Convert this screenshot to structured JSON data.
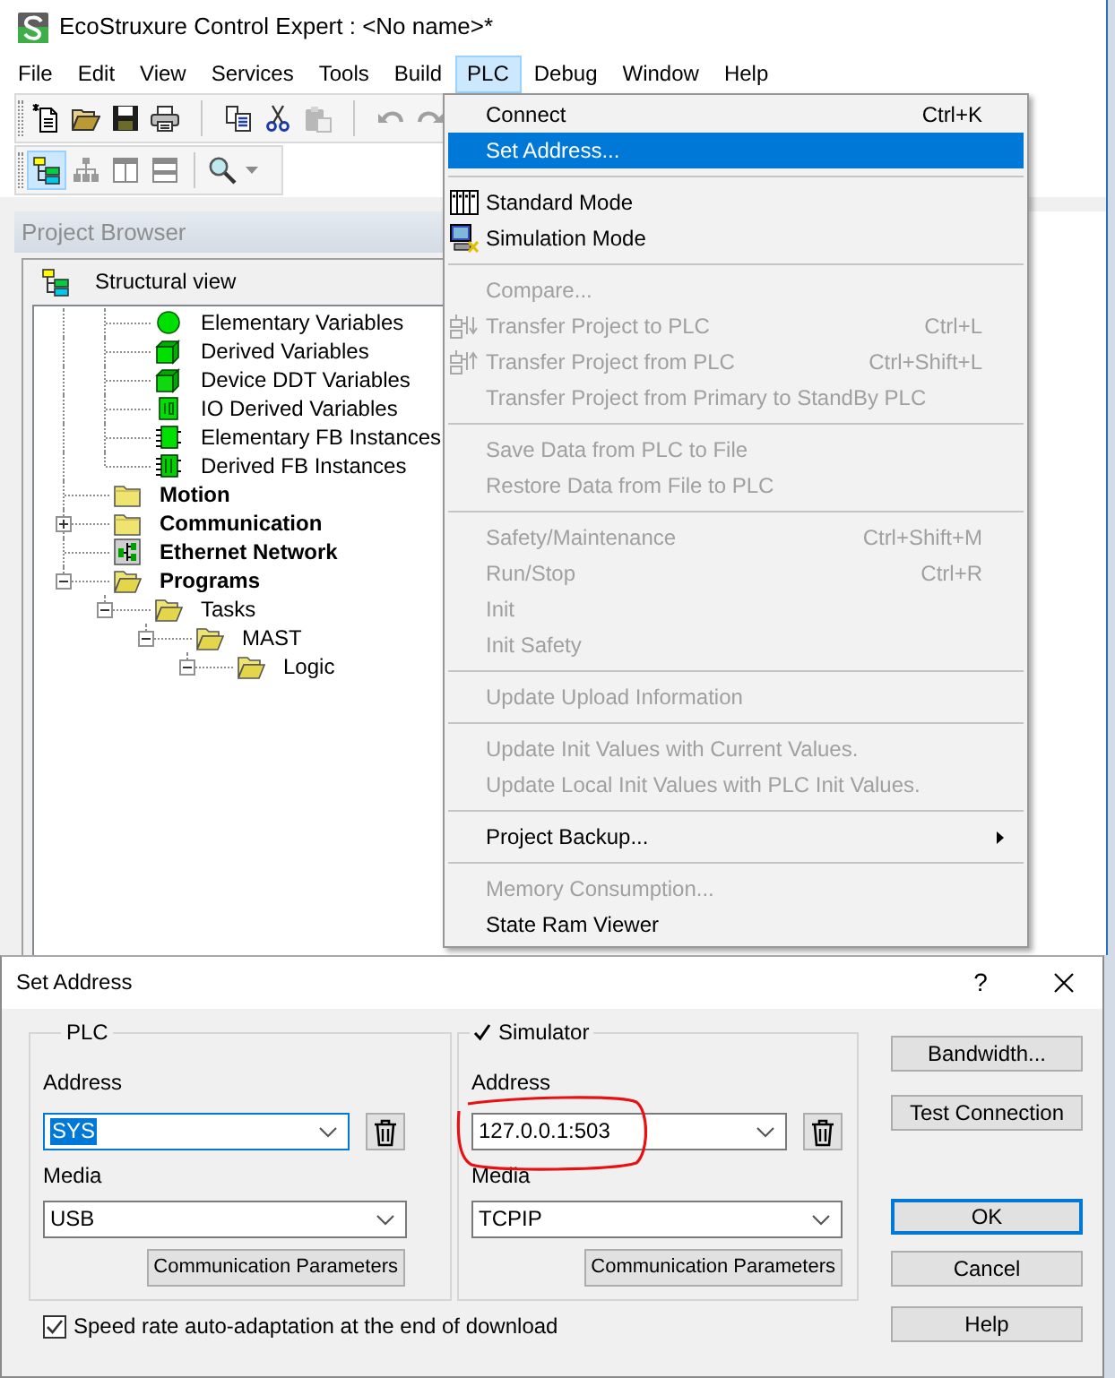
{
  "window": {
    "title": "EcoStruxure Control Expert : <No name>*"
  },
  "menu_bar": [
    {
      "label": "File",
      "selected": false
    },
    {
      "label": "Edit",
      "selected": false
    },
    {
      "label": "View",
      "selected": false
    },
    {
      "label": "Services",
      "selected": false
    },
    {
      "label": "Tools",
      "selected": false
    },
    {
      "label": "Build",
      "selected": false
    },
    {
      "label": "PLC",
      "selected": true
    },
    {
      "label": "Debug",
      "selected": false
    },
    {
      "label": "Window",
      "selected": false
    },
    {
      "label": "Help",
      "selected": false
    }
  ],
  "toolbars": [
    {
      "groups": [
        [
          {
            "kind": "new",
            "disabled": false
          },
          {
            "kind": "open",
            "disabled": false
          },
          {
            "kind": "save",
            "disabled": false
          },
          {
            "kind": "print",
            "disabled": false
          }
        ],
        [
          {
            "kind": "copy",
            "disabled": false
          },
          {
            "kind": "cut",
            "disabled": false
          },
          {
            "kind": "paste",
            "disabled": true
          }
        ],
        [
          {
            "kind": "undo",
            "disabled": true
          },
          {
            "kind": "redo",
            "disabled": true
          }
        ]
      ]
    },
    {
      "groups": [
        [
          {
            "kind": "structural-view",
            "disabled": false,
            "pressed": true
          },
          {
            "kind": "functional-view",
            "disabled": false,
            "pressed": false
          },
          {
            "kind": "two-pane",
            "disabled": false,
            "pressed": false
          },
          {
            "kind": "split-pane",
            "disabled": false,
            "pressed": false
          }
        ],
        [
          {
            "kind": "zoom",
            "disabled": false,
            "pressed": false
          }
        ]
      ]
    }
  ],
  "project_browser": {
    "title": "Project Browser",
    "view": "Structural view",
    "tree": [
      {
        "children": [
          {
            "kind": "elementary-variable",
            "label": "Elementary Variables"
          },
          {
            "kind": "derived-variable",
            "label": "Derived Variables"
          },
          {
            "kind": "device-ddt",
            "label": "Device DDT Variables"
          },
          {
            "kind": "io-derived",
            "label": "IO Derived Variables"
          },
          {
            "kind": "elementary-fb",
            "label": "Elementary FB Instances"
          },
          {
            "kind": "derived-fb",
            "label": "Derived FB Instances"
          }
        ]
      },
      {
        "kind": "folder",
        "label": "Motion"
      },
      {
        "kind": "folder",
        "label": "Communication",
        "expanded": false
      },
      {
        "kind": "network",
        "label": "Ethernet Network"
      },
      {
        "kind": "folder",
        "label": "Programs",
        "expanded": true,
        "children": [
          {
            "kind": "folder",
            "label": "Tasks",
            "expanded": true,
            "children": [
              {
                "kind": "folder",
                "label": "MAST",
                "expanded": true,
                "children": [
                  {
                    "kind": "folder",
                    "label": "Logic",
                    "expanded": true
                  }
                ]
              }
            ]
          }
        ]
      }
    ]
  },
  "menu": {
    "items": [
      {
        "kind": "plain",
        "label": "Connect",
        "shortcut": "Ctrl+K",
        "disabled": false,
        "selected": false
      },
      {
        "kind": "plain",
        "label": "Set Address...",
        "disabled": false,
        "selected": true
      },
      {
        "kind": "separator"
      },
      {
        "kind": "rack",
        "label": "Standard Mode",
        "disabled": false,
        "selected": false
      },
      {
        "kind": "simulator",
        "label": "Simulation Mode",
        "disabled": false,
        "selected": false
      },
      {
        "kind": "separator"
      },
      {
        "kind": "plain",
        "label": "Compare...",
        "disabled": true,
        "selected": false
      },
      {
        "kind": "transfer-to",
        "label": "Transfer Project to PLC",
        "shortcut": "Ctrl+L",
        "disabled": true,
        "selected": false
      },
      {
        "kind": "transfer-from",
        "label": "Transfer Project from PLC",
        "shortcut": "Ctrl+Shift+L",
        "disabled": true,
        "selected": false
      },
      {
        "kind": "plain",
        "label": "Transfer Project from Primary to StandBy PLC",
        "disabled": true,
        "selected": false
      },
      {
        "kind": "separator"
      },
      {
        "kind": "plain",
        "label": "Save Data from PLC to File",
        "disabled": true,
        "selected": false
      },
      {
        "kind": "plain",
        "label": "Restore Data from File to PLC",
        "disabled": true,
        "selected": false
      },
      {
        "kind": "separator"
      },
      {
        "kind": "plain",
        "label": "Safety/Maintenance",
        "shortcut": "Ctrl+Shift+M",
        "disabled": true,
        "selected": false
      },
      {
        "kind": "plain",
        "label": "Run/Stop",
        "shortcut": "Ctrl+R",
        "disabled": true,
        "selected": false
      },
      {
        "kind": "plain",
        "label": "Init",
        "disabled": true,
        "selected": false
      },
      {
        "kind": "plain",
        "label": "Init Safety",
        "disabled": true,
        "selected": false
      },
      {
        "kind": "separator"
      },
      {
        "kind": "plain",
        "label": "Update Upload Information",
        "disabled": true,
        "selected": false
      },
      {
        "kind": "separator"
      },
      {
        "kind": "plain",
        "label": "Update Init Values with Current Values.",
        "disabled": true,
        "selected": false
      },
      {
        "kind": "plain",
        "label": "Update Local Init Values with PLC Init Values.",
        "disabled": true,
        "selected": false
      },
      {
        "kind": "separator"
      },
      {
        "kind": "submenu",
        "label": "Project Backup...",
        "disabled": false,
        "selected": false
      },
      {
        "kind": "separator"
      },
      {
        "kind": "plain",
        "label": "Memory Consumption...",
        "disabled": true,
        "selected": false
      },
      {
        "kind": "plain",
        "label": "State Ram Viewer",
        "disabled": false,
        "selected": false
      }
    ]
  },
  "dialog": {
    "title": "Set Address",
    "help_button": "?",
    "plc": {
      "title": "PLC",
      "address_label": "Address",
      "address": "SYS",
      "address_focused": true,
      "media_label": "Media",
      "media": "USB",
      "parameters_button": "Communication Parameters"
    },
    "simulator": {
      "title": "Simulator",
      "checked": true,
      "address_label": "Address",
      "address": "127.0.0.1:503",
      "circled": true,
      "media_label": "Media",
      "media": "TCPIP",
      "parameters_button": "Communication Parameters"
    },
    "side_buttons": [
      {
        "label": "Bandwidth...",
        "default": false
      },
      {
        "label": "Test Connection",
        "default": false
      }
    ],
    "action_buttons": [
      {
        "label": "OK",
        "default": true
      },
      {
        "label": "Cancel",
        "default": false
      },
      {
        "label": "Help",
        "default": false
      }
    ],
    "speed_adaptation": {
      "label": "Speed rate auto-adaptation at the end of download",
      "checked": true
    }
  }
}
